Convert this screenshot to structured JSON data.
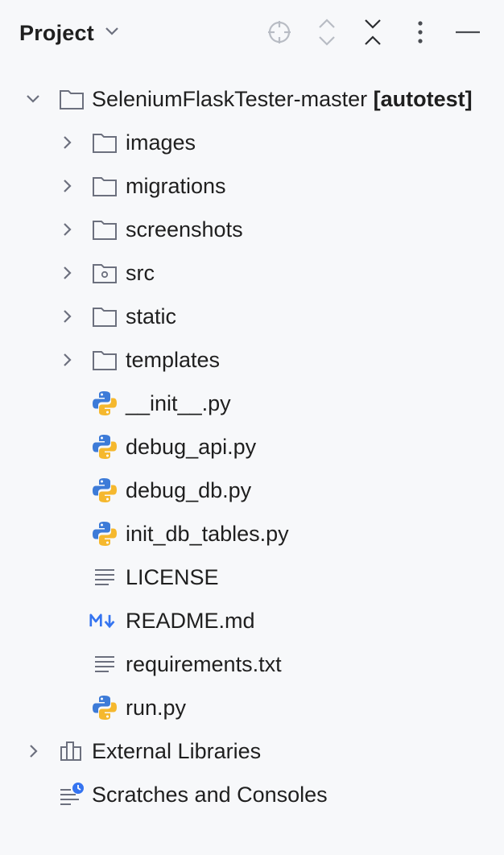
{
  "header": {
    "title": "Project"
  },
  "toolbar": {
    "icons": [
      "locate-icon",
      "expand-all-icon",
      "collapse-all-icon",
      "more-icon",
      "minimize-icon"
    ]
  },
  "tree": {
    "root": {
      "name": "SeleniumFlaskTester-master",
      "module": "[autotest]"
    },
    "folders": [
      {
        "name": "images"
      },
      {
        "name": "migrations"
      },
      {
        "name": "screenshots"
      },
      {
        "name": "src"
      },
      {
        "name": "static"
      },
      {
        "name": "templates"
      }
    ],
    "files": [
      {
        "name": "__init__.py",
        "icon": "python-icon"
      },
      {
        "name": "debug_api.py",
        "icon": "python-icon"
      },
      {
        "name": "debug_db.py",
        "icon": "python-icon"
      },
      {
        "name": "init_db_tables.py",
        "icon": "python-icon"
      },
      {
        "name": "LICENSE",
        "icon": "text-file-icon"
      },
      {
        "name": "README.md",
        "icon": "markdown-icon"
      },
      {
        "name": "requirements.txt",
        "icon": "text-file-icon"
      },
      {
        "name": "run.py",
        "icon": "python-icon"
      }
    ],
    "external_libraries": "External Libraries",
    "scratches": "Scratches and Consoles"
  },
  "colors": {
    "background": "#f7f8fa",
    "python_blue": "#3d7bd8",
    "python_yellow": "#f5b82e",
    "markdown_blue": "#3574f0",
    "icon_gray": "#6c707e"
  }
}
